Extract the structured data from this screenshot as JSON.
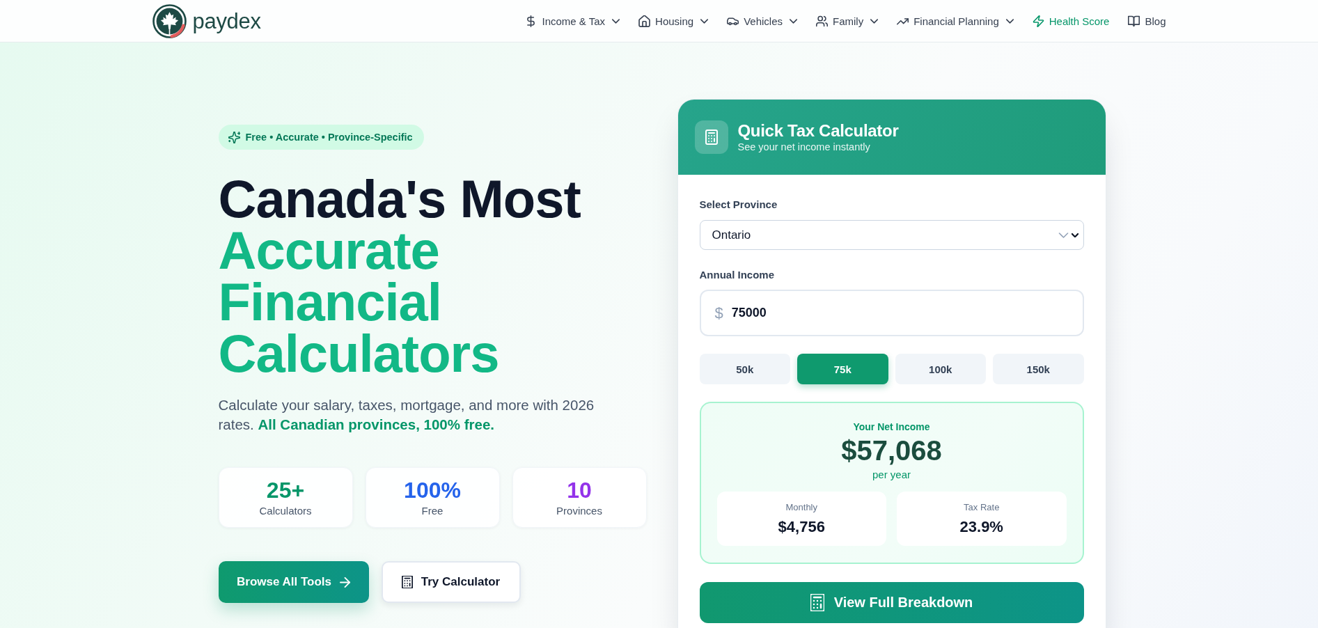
{
  "header": {
    "logo_text": "paydex",
    "nav": [
      {
        "label": "Income & Tax",
        "kind": "dropdown",
        "highlighted": false
      },
      {
        "label": "Housing",
        "kind": "dropdown",
        "highlighted": false
      },
      {
        "label": "Vehicles",
        "kind": "dropdown",
        "highlighted": false
      },
      {
        "label": "Family",
        "kind": "dropdown",
        "highlighted": false
      },
      {
        "label": "Financial Planning",
        "kind": "dropdown",
        "highlighted": false
      },
      {
        "label": "Health Score",
        "kind": "link",
        "highlighted": true
      },
      {
        "label": "Blog",
        "kind": "link",
        "highlighted": false
      }
    ]
  },
  "hero": {
    "badge": "Free • Accurate • Province-Specific",
    "title": "Canada's Most",
    "title_highlight": "Accurate Financial Calculators",
    "description": "Calculate your salary, taxes, mortgage, and more with 2026 rates. **All Canadian provinces, 100% free.**",
    "stats": [
      {
        "value": "25+",
        "label": "Calculators",
        "color": "#059669"
      },
      {
        "value": "100%",
        "label": "Free",
        "color": "#2563eb"
      },
      {
        "value": "10",
        "label": "Provinces",
        "color": "#9333ea"
      }
    ],
    "buttons": [
      {
        "label": "Browse All Tools",
        "kind": "primary"
      },
      {
        "label": "Try Calculator",
        "kind": "secondary"
      }
    ]
  },
  "calculator": {
    "title": "Quick Tax Calculator",
    "subtitle": "See your net income instantly",
    "province_label": "Select Province",
    "province_value": "Ontario",
    "income_label": "Annual Income",
    "currency_symbol": "$",
    "income_value": "75000",
    "presets": [
      {
        "label": "50k",
        "selected": false
      },
      {
        "label": "75k",
        "selected": true
      },
      {
        "label": "100k",
        "selected": false
      },
      {
        "label": "150k",
        "selected": false
      }
    ],
    "result": {
      "label": "Your Net Income",
      "amount": "$57,068",
      "period": "per year",
      "breakdown": [
        {
          "label": "Monthly",
          "value": "$4,756"
        },
        {
          "label": "Tax Rate",
          "value": "23.9%"
        }
      ]
    },
    "action_button": "View Full Breakdown"
  }
}
